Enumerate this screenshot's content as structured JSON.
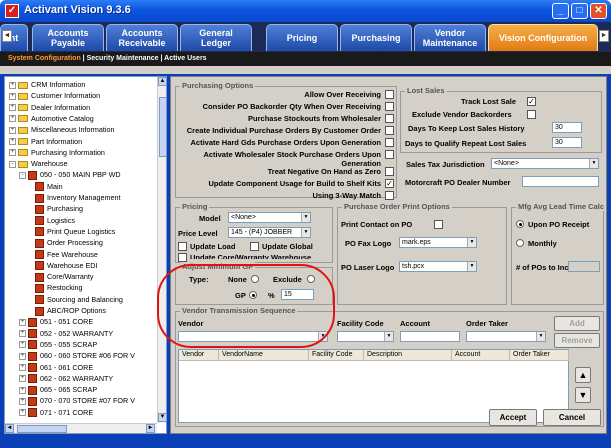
{
  "window": {
    "title": "Activant Vision 9.3.6",
    "minimize_glyph": "_",
    "maximize_glyph": "□",
    "close_glyph": "✕",
    "app_icon_glyph": "✓"
  },
  "tabs": [
    {
      "label": "nt",
      "active": false
    },
    {
      "label": "Accounts Payable",
      "active": false
    },
    {
      "label": "Accounts Receivable",
      "active": false
    },
    {
      "label": "General Ledger",
      "active": false
    },
    {
      "label": "Pricing",
      "active": false
    },
    {
      "label": "Purchasing",
      "active": false
    },
    {
      "label": "Vendor Maintenance",
      "active": false
    },
    {
      "label": "Vision Configuration",
      "active": true
    }
  ],
  "tab_arrows": {
    "left": "◄",
    "right": "►"
  },
  "subnav": {
    "items": [
      "System Configuration",
      "Security Maintenance",
      "Active Users"
    ],
    "active_index": 0,
    "separator": " | "
  },
  "tree": {
    "items": [
      {
        "label": "CRM Information",
        "kind": "folder",
        "expander": "+"
      },
      {
        "label": "Customer Information",
        "kind": "folder",
        "expander": "+"
      },
      {
        "label": "Dealer Information",
        "kind": "folder",
        "expander": "+"
      },
      {
        "label": "Automotive Catalog",
        "kind": "folder",
        "expander": "+"
      },
      {
        "label": "Miscellaneous Information",
        "kind": "folder",
        "expander": "+"
      },
      {
        "label": "Part Information",
        "kind": "folder",
        "expander": "+"
      },
      {
        "label": "Purchasing Information",
        "kind": "folder",
        "expander": "+"
      },
      {
        "label": "Warehouse",
        "kind": "folder",
        "expander": "-"
      },
      {
        "label": "050 - 050 MAIN PBP WD",
        "kind": "store",
        "expander": "-"
      },
      {
        "label": "Main",
        "kind": "page"
      },
      {
        "label": "Inventory Management",
        "kind": "page"
      },
      {
        "label": "Purchasing",
        "kind": "page"
      },
      {
        "label": "Logistics",
        "kind": "page"
      },
      {
        "label": "Print Queue Logistics",
        "kind": "page"
      },
      {
        "label": "Order Processing",
        "kind": "page"
      },
      {
        "label": "Fee Warehouse",
        "kind": "page"
      },
      {
        "label": "Warehouse EDI",
        "kind": "page"
      },
      {
        "label": "Core/Warranty",
        "kind": "page"
      },
      {
        "label": "Restocking",
        "kind": "page"
      },
      {
        "label": "Sourcing and Balancing",
        "kind": "page"
      },
      {
        "label": "ABC/ROP Options",
        "kind": "page"
      },
      {
        "label": "051 - 051 CORE",
        "kind": "store",
        "expander": "+"
      },
      {
        "label": "052 - 052 WARRANTY",
        "kind": "store",
        "expander": "+"
      },
      {
        "label": "055 - 055 SCRAP",
        "kind": "store",
        "expander": "+"
      },
      {
        "label": "060 - 060 STORE #06 FOR V",
        "kind": "store",
        "expander": "+"
      },
      {
        "label": "061 - 061 CORE",
        "kind": "store",
        "expander": "+"
      },
      {
        "label": "062 - 062 WARRANTY",
        "kind": "store",
        "expander": "+"
      },
      {
        "label": "065 - 065 SCRAP",
        "kind": "store",
        "expander": "+"
      },
      {
        "label": "070 - 070 STORE #07 FOR V",
        "kind": "store",
        "expander": "+"
      },
      {
        "label": "071 - 071 CORE",
        "kind": "store",
        "expander": "+"
      }
    ],
    "scroll_up": "▲",
    "scroll_down": "▼",
    "scroll_left": "◄",
    "scroll_right": "►"
  },
  "purchasing_options": {
    "legend": "Purchasing Options",
    "rows": [
      {
        "label": "Allow Over Receiving",
        "checked": false
      },
      {
        "label": "Consider PO Backorder Qty When Over Receiving",
        "checked": false
      },
      {
        "label": "Purchase Stockouts from Wholesaler",
        "checked": false
      },
      {
        "label": "Create Individual Purchase Orders By Customer Order",
        "checked": false
      },
      {
        "label": "Activate Hard Gds Purchase Orders Upon Generation",
        "checked": false
      },
      {
        "label": "Activate Wholesaler Stock Purchase Orders Upon",
        "label2": "Generation",
        "checked": false
      },
      {
        "label": "Treat Negative On Hand as Zero",
        "checked": false
      },
      {
        "label": "Update Component Usage for Build to Shelf Kits",
        "checked": true
      },
      {
        "label": "Using 3-Way Match",
        "checked": false
      }
    ],
    "check_glyph": "✓"
  },
  "lost_sales": {
    "legend": "Lost Sales",
    "track_label": "Track Lost Sale",
    "track_checked": true,
    "exclude_label": "Exclude Vendor Backorders",
    "exclude_checked": false,
    "days_history_label": "Days To Keep Lost Sales History",
    "days_history_value": "30",
    "days_qualify_label": "Days to Qualify Repeat Lost Sales",
    "days_qualify_value": "30"
  },
  "sales_tax": {
    "label": "Sales Tax Jurisdiction",
    "value": "<None>"
  },
  "motorcraft": {
    "label": "Motorcraft PO Dealer Number",
    "value": ""
  },
  "pricing": {
    "legend": "Pricing",
    "model_label": "Model",
    "model_value": "<None>",
    "price_level_label": "Price Level",
    "price_level_value": "145 - (P4) JOBBER",
    "update_load_label": "Update Load",
    "update_load_checked": false,
    "update_global_label": "Update Global",
    "update_global_checked": false,
    "update_core_label": "Update Core/Warranty Warehouse",
    "update_core_checked": false
  },
  "adjust_gp": {
    "legend": "Adjust Minimum GP",
    "type_label": "Type:",
    "none_label": "None",
    "none_selected": false,
    "exclude_label": "Exclude",
    "exclude_selected": false,
    "gp_label": "GP",
    "gp_selected": true,
    "pct_label": "%",
    "pct_value": "15"
  },
  "purchase_order_print": {
    "legend": "Purchase Order Print Options",
    "print_contact_label": "Print Contact on PO",
    "print_contact_checked": false,
    "fax_logo_label": "PO Fax Logo",
    "fax_logo_value": "mark.eps",
    "laser_logo_label": "PO Laser Logo",
    "laser_logo_value": "tsh.pcx"
  },
  "mfg_avg": {
    "legend": "Mfg Avg Lead Time Calc",
    "upon_po_label": "Upon PO Receipt",
    "upon_po_selected": true,
    "monthly_label": "Monthly",
    "monthly_selected": false,
    "num_pos_label": "# of POs to Include",
    "num_pos_value": ""
  },
  "vendor_transmission": {
    "legend": "Vendor Transmission Sequence",
    "vendor_label": "Vendor",
    "facility_label": "Facility Code",
    "account_label": "Account",
    "order_taker_label": "Order Taker",
    "add_label": "Add",
    "remove_label": "Remove",
    "columns": [
      "Vendor",
      "VendorName",
      "Facility Code",
      "Description",
      "Account",
      "Order Taker"
    ],
    "up_glyph": "▲",
    "down_glyph": "▼"
  },
  "footer": {
    "accept_label": "Accept",
    "cancel_label": "Cancel"
  },
  "colors": {
    "titlebar": "#0b55e0",
    "active_tab": "#f29a2e",
    "highlight_circle": "#e31212",
    "panel": "#d4d0c8"
  }
}
